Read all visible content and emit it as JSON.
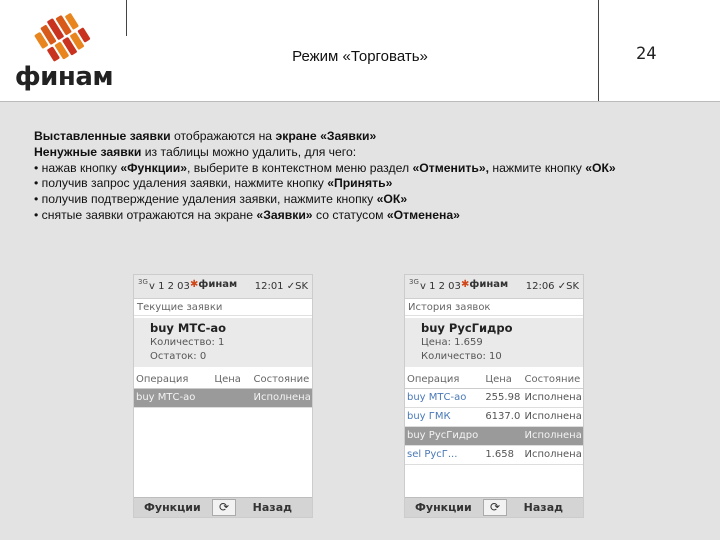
{
  "header": {
    "logo_text": "финам",
    "title": "Режим «Торговать»",
    "page_number": "24"
  },
  "body_lines": [
    [
      {
        "t": "Выставленные заявки",
        "b": true
      },
      {
        "t": " отображаются на ",
        "b": false
      },
      {
        "t": "экране «Заявки»",
        "b": true
      }
    ],
    [
      {
        "t": "Ненужные заявки",
        "b": true
      },
      {
        "t": " из таблицы можно удалить, для чего:",
        "b": false
      }
    ],
    [
      {
        "t": "• нажав кнопку ",
        "b": false
      },
      {
        "t": "«Функции»",
        "b": true
      },
      {
        "t": ", выберите в контекстном меню раздел ",
        "b": false
      },
      {
        "t": "«Отменить»,",
        "b": true
      },
      {
        "t": " нажмите кнопку ",
        "b": false
      },
      {
        "t": "«ОК»",
        "b": true
      }
    ],
    [
      {
        "t": "• получив запрос удаления заявки, нажмите кнопку ",
        "b": false
      },
      {
        "t": "«Принять»",
        "b": true
      }
    ],
    [
      {
        "t": "• получив подтверждение удаления заявки, нажмите кнопку ",
        "b": false
      },
      {
        "t": "«ОК»",
        "b": true
      }
    ],
    [
      {
        "t": "• снятые заявки отражаются на экране ",
        "b": false
      },
      {
        "t": "«Заявки»",
        "b": true
      },
      {
        "t": " со статусом ",
        "b": false
      },
      {
        "t": "«Отменена»",
        "b": true
      }
    ]
  ],
  "phones": [
    {
      "status_net": "3G",
      "status_ver": "v 1 2 03",
      "status_logo": "финам",
      "status_time": "12:01 ✓SK",
      "screen_title": "Текущие заявки",
      "card": {
        "name": "buy МТС-ао",
        "lines": [
          "Количество: 1",
          "Остаток: 0"
        ]
      },
      "columns": [
        "Операция",
        "Цена",
        "Состояние"
      ],
      "rows": [
        {
          "instr": "buy МТС-ао",
          "price": "",
          "status": "Исполнена",
          "selected": true
        }
      ],
      "btn_left": "Функции",
      "btn_refresh": "⟳",
      "btn_right": "Назад"
    },
    {
      "status_net": "3G",
      "status_ver": "v 1 2 03",
      "status_logo": "финам",
      "status_time": "12:06 ✓SK",
      "screen_title": "История заявок",
      "card": {
        "name": "buy РусГидро",
        "lines": [
          "Цена: 1.659",
          "Количество: 10"
        ]
      },
      "columns": [
        "Операция",
        "Цена",
        "Состояние"
      ],
      "rows": [
        {
          "instr": "buy МТС-ао",
          "price": "255.98",
          "status": "Исполнена",
          "selected": false
        },
        {
          "instr": "buy ГМК",
          "price": "6137.0",
          "status": "Исполнена",
          "selected": false
        },
        {
          "instr": "buy РусГидро",
          "price": "",
          "status": "Исполнена",
          "selected": true
        },
        {
          "instr": "sel РусГ...",
          "price": "1.658",
          "status": "Исполнена",
          "selected": false
        }
      ],
      "btn_left": "Функции",
      "btn_refresh": "⟳",
      "btn_right": "Назад"
    }
  ],
  "colors": {
    "accent_red": "#c8321e",
    "accent_orange": "#e8851e",
    "content_bg": "#e3e3e3",
    "link_blue": "#4a79b5"
  }
}
